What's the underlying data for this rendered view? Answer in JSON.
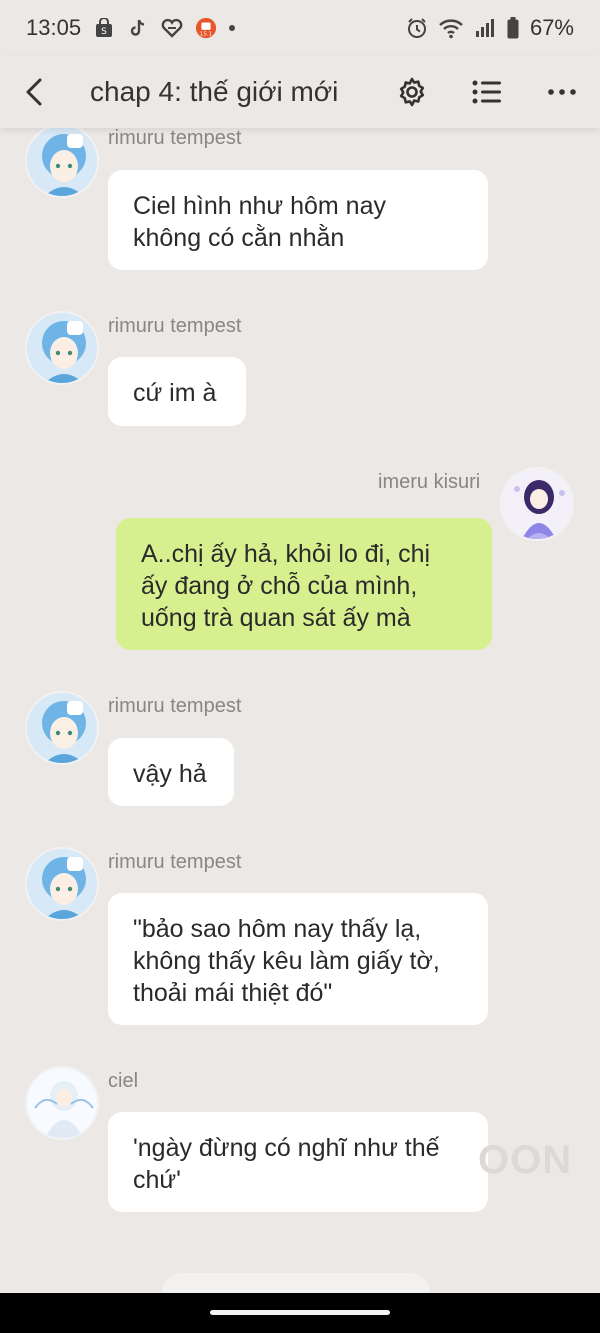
{
  "status_bar": {
    "time": "13:05",
    "battery": "67%",
    "left_icons": [
      "shopping-bag-icon",
      "tiktok-icon",
      "heart-link-icon",
      "app-badge-icon"
    ],
    "right_icons": [
      "alarm-icon",
      "wifi-icon",
      "signal-icon",
      "battery-icon"
    ]
  },
  "header": {
    "title": "chap 4: thế giới mới",
    "back_icon": "chevron-left-icon",
    "settings_icon": "gear-icon",
    "list_icon": "list-icon",
    "more_icon": "more-dots-icon"
  },
  "messages": [
    {
      "sender": "rimuru tempest",
      "text_lines": [
        "Ciel hình như hôm nay",
        "không có cằn nhằn"
      ],
      "side": "left",
      "avatar": "rimuru"
    },
    {
      "sender": "rimuru tempest",
      "text_lines": [
        "cứ im à"
      ],
      "side": "left",
      "avatar": "rimuru"
    },
    {
      "sender": "imeru kisuri",
      "text_lines": [
        "A..chị ấy hả, khỏi lo đi, chị",
        "ấy đang ở chỗ của mình,",
        "uống trà quan sát ấy mà"
      ],
      "side": "right",
      "avatar": "imeru"
    },
    {
      "sender": "rimuru tempest",
      "text_lines": [
        "vậy hả"
      ],
      "side": "left",
      "avatar": "rimuru"
    },
    {
      "sender": "rimuru tempest",
      "text_lines": [
        "\"bảo sao hôm nay thấy lạ,",
        "không thấy kêu làm giấy tờ,",
        "thoải mái thiệt đó\""
      ],
      "side": "left",
      "avatar": "rimuru"
    },
    {
      "sender": "ciel",
      "text_lines": [
        "'ngày đừng có nghĩ như thế",
        "chứ'"
      ],
      "side": "left",
      "avatar": "ciel"
    }
  ],
  "watermark": "OON",
  "colors": {
    "background": "#ebe8e6",
    "bubble_other": "#ffffff",
    "bubble_me": "#d6f08f",
    "name_text": "#8a8684"
  }
}
